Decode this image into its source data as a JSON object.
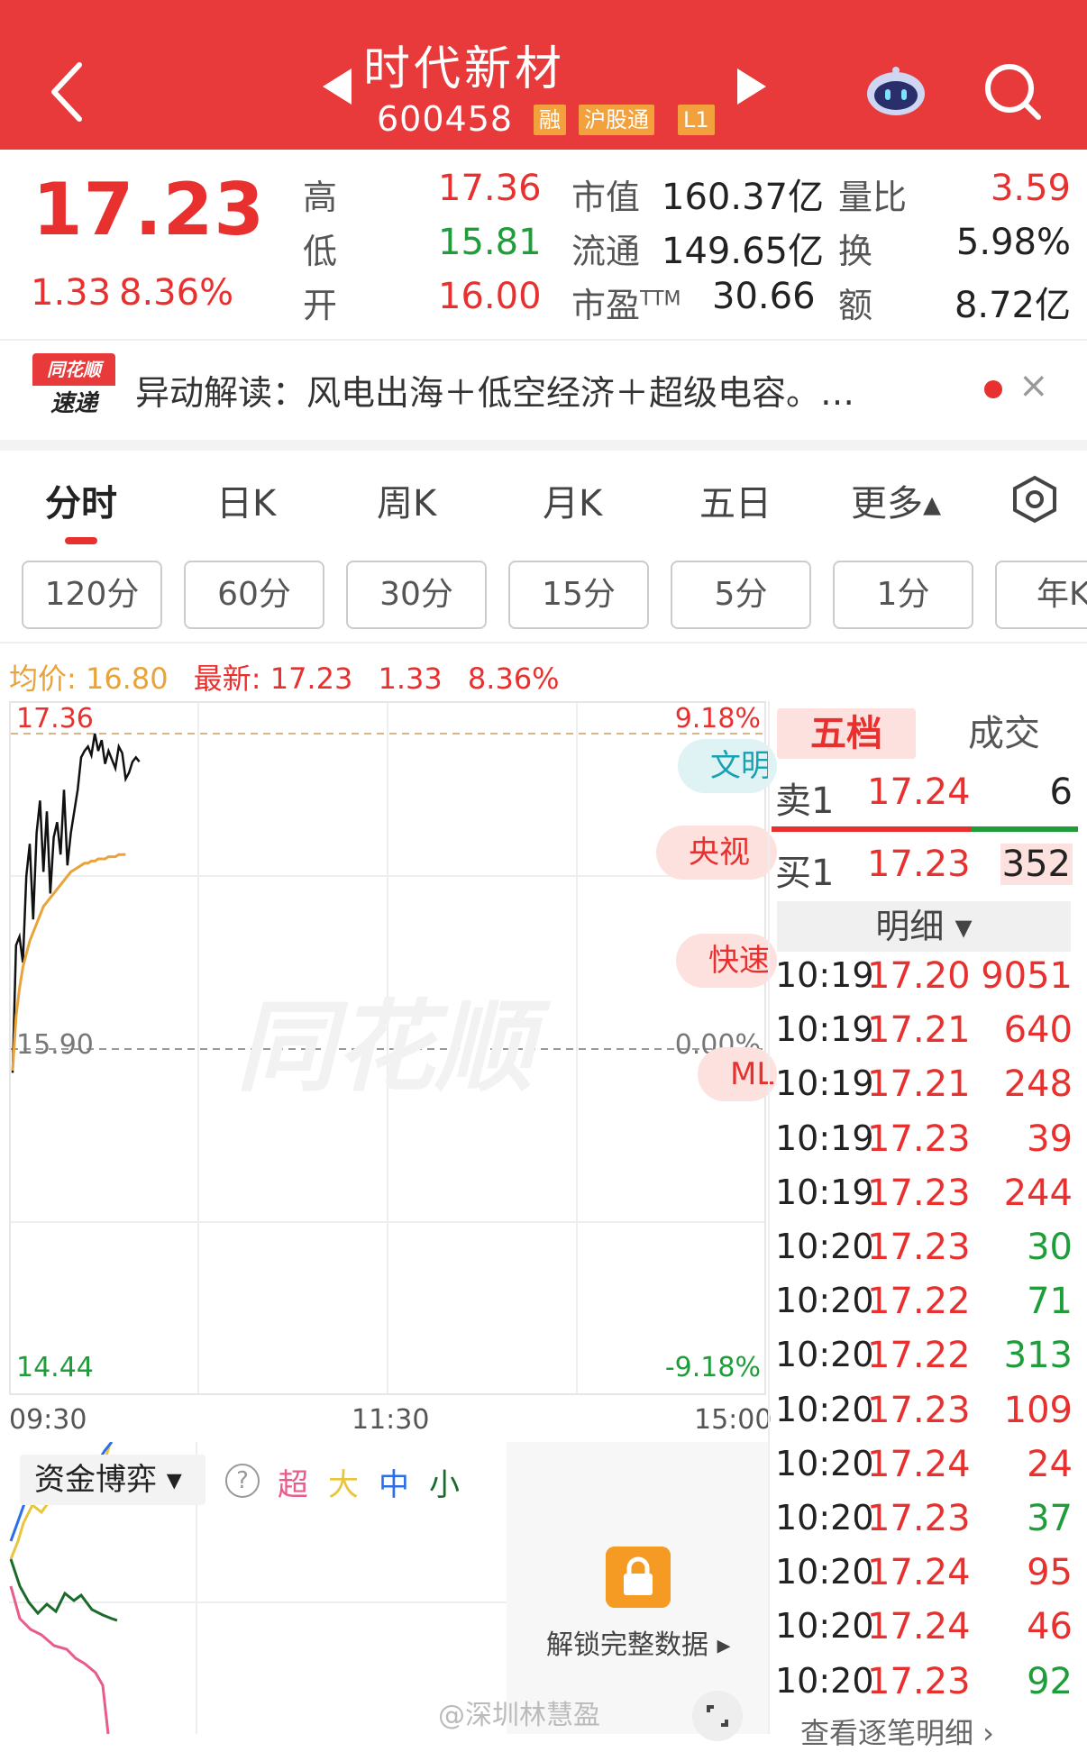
{
  "header": {
    "stock_name": "时代新材",
    "stock_code": "600458",
    "badges": [
      "融",
      "沪股通",
      "L1"
    ]
  },
  "quote": {
    "price": "17.23",
    "change": "1.33",
    "change_pct": "8.36%",
    "high_label": "高",
    "high": "17.36",
    "low_label": "低",
    "low": "15.81",
    "open_label": "开",
    "open": "16.00",
    "mcap_label": "市值",
    "mcap": "160.37亿",
    "float_label": "流通",
    "float": "149.65亿",
    "pe_label": "市盈",
    "pe_sup": "TTM",
    "pe": "30.66",
    "volratio_label": "量比",
    "volratio": "3.59",
    "turnover_label": "换",
    "turnover": "5.98%",
    "amount_label": "额",
    "amount": "8.72亿"
  },
  "news": {
    "logo_line1": "同花顺",
    "logo_line2": "速递",
    "text": "异动解读：风电出海＋低空经济＋超级电容。…",
    "close": "×"
  },
  "tabs": [
    "分时",
    "日K",
    "周K",
    "月K",
    "五日",
    "更多▴"
  ],
  "periods": [
    "120分",
    "60分",
    "30分",
    "15分",
    "5分",
    "1分",
    "年K"
  ],
  "chart_info": {
    "avg_label": "均价: 16.80",
    "latest_label": "最新: 17.23",
    "change": "1.33",
    "change_pct": "8.36%"
  },
  "chart_data": {
    "type": "line",
    "y_top": "17.36",
    "y_mid": "15.90",
    "y_bottom": "14.44",
    "pct_top": "9.18%",
    "pct_mid": "0.00%",
    "pct_bottom": "-9.18%",
    "x_ticks": [
      "09:30",
      "11:30",
      "15:00"
    ],
    "ylim": [
      14.44,
      17.36
    ],
    "series": [
      {
        "color": "#111111",
        "values": [
          15.79,
          16.38,
          16.42,
          16.3,
          16.7,
          16.85,
          16.5,
          16.9,
          17.05,
          16.72,
          17.0,
          16.62,
          16.88,
          16.95,
          16.8,
          17.1,
          16.75,
          16.9,
          17.0,
          17.1,
          17.25,
          17.28,
          17.3,
          17.26,
          17.36,
          17.28,
          17.33,
          17.22,
          17.28,
          17.24,
          17.2,
          17.3,
          17.27,
          17.15,
          17.18,
          17.23,
          17.25,
          17.23
        ]
      },
      {
        "color": "#e8a33a",
        "values": [
          15.8,
          16.05,
          16.18,
          16.28,
          16.34,
          16.4,
          16.44,
          16.48,
          16.52,
          16.56,
          16.58,
          16.6,
          16.62,
          16.64,
          16.66,
          16.68,
          16.7,
          16.72,
          16.73,
          16.74,
          16.75,
          16.76,
          16.76,
          16.77,
          16.77,
          16.78,
          16.78,
          16.78,
          16.79,
          16.79,
          16.79,
          16.8,
          16.8,
          16.8
        ]
      }
    ]
  },
  "bubbles": [
    "文明",
    "央视财",
    "快速",
    "ML"
  ],
  "orderbook": {
    "tab_active": "五档",
    "tab_other": "成交",
    "ask_label": "卖1",
    "ask_price": "17.24",
    "ask_vol": "6",
    "bid_label": "买1",
    "bid_price": "17.23",
    "bid_vol": "352",
    "detail_label": "明细 ▾",
    "ticks": [
      {
        "time": "10:19",
        "price": "17.20",
        "vol": "9051",
        "pcolor": "red",
        "vcolor": "red"
      },
      {
        "time": "10:19",
        "price": "17.21",
        "vol": "640",
        "pcolor": "red",
        "vcolor": "red"
      },
      {
        "time": "10:19",
        "price": "17.21",
        "vol": "248",
        "pcolor": "red",
        "vcolor": "red"
      },
      {
        "time": "10:19",
        "price": "17.23",
        "vol": "39",
        "pcolor": "red",
        "vcolor": "red"
      },
      {
        "time": "10:19",
        "price": "17.23",
        "vol": "244",
        "pcolor": "red",
        "vcolor": "red"
      },
      {
        "time": "10:20",
        "price": "17.23",
        "vol": "30",
        "pcolor": "red",
        "vcolor": "green"
      },
      {
        "time": "10:20",
        "price": "17.22",
        "vol": "71",
        "pcolor": "red",
        "vcolor": "green"
      },
      {
        "time": "10:20",
        "price": "17.22",
        "vol": "313",
        "pcolor": "red",
        "vcolor": "green"
      },
      {
        "time": "10:20",
        "price": "17.23",
        "vol": "109",
        "pcolor": "red",
        "vcolor": "red"
      },
      {
        "time": "10:20",
        "price": "17.24",
        "vol": "24",
        "pcolor": "red",
        "vcolor": "red"
      },
      {
        "time": "10:20",
        "price": "17.23",
        "vol": "37",
        "pcolor": "red",
        "vcolor": "green"
      },
      {
        "time": "10:20",
        "price": "17.24",
        "vol": "95",
        "pcolor": "red",
        "vcolor": "red"
      },
      {
        "time": "10:20",
        "price": "17.24",
        "vol": "46",
        "pcolor": "red",
        "vcolor": "red"
      },
      {
        "time": "10:20",
        "price": "17.23",
        "vol": "92",
        "pcolor": "red",
        "vcolor": "green"
      }
    ],
    "more_detail": "查看逐笔明细 ›"
  },
  "capital": {
    "label": "资金博弈 ▾",
    "help": "?",
    "legend": [
      {
        "text": "超",
        "color": "#e85c8a"
      },
      {
        "text": "大",
        "color": "#e8c53a"
      },
      {
        "text": "中",
        "color": "#2a6ee8"
      },
      {
        "text": "小",
        "color": "#1a6b2a"
      }
    ],
    "unlock_text": "解锁完整数据 ▸"
  },
  "watermark": "@深圳林慧盈",
  "brand_watermark": "同花顺"
}
